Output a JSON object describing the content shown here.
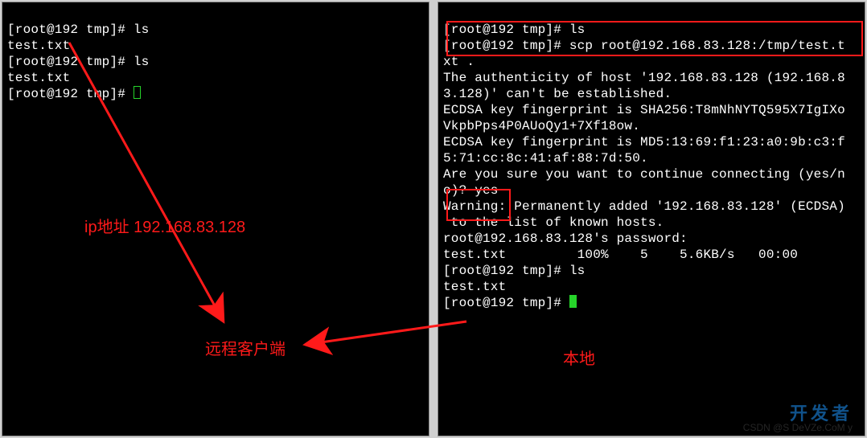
{
  "left_terminal": {
    "lines": [
      "[root@192 tmp]# ls",
      "test.txt",
      "[root@192 tmp]# ls",
      "test.txt",
      "[root@192 tmp]# "
    ]
  },
  "right_terminal": {
    "lines": [
      "[root@192 tmp]# ls",
      "[root@192 tmp]# scp root@192.168.83.128:/tmp/test.t",
      "xt .",
      "The authenticity of host '192.168.83.128 (192.168.8",
      "3.128)' can't be established.",
      "ECDSA key fingerprint is SHA256:T8mNhNYTQ595X7IgIXo",
      "VkpbPps4P0AUoQy1+7Xf18ow.",
      "ECDSA key fingerprint is MD5:13:69:f1:23:a0:9b:c3:f",
      "5:71:cc:8c:41:af:88:7d:50.",
      "Are you sure you want to continue connecting (yes/n",
      "o)? yes",
      "Warning: Permanently added '192.168.83.128' (ECDSA)",
      " to the list of known hosts.",
      "root@192.168.83.128's password:",
      "test.txt         100%    5    5.6KB/s   00:00",
      "[root@192 tmp]# ls",
      "test.txt",
      "[root@192 tmp]# "
    ]
  },
  "annotations": {
    "ip_label": "ip地址 192.168.83.128",
    "remote_label": "远程客户端",
    "local_label": "本地"
  },
  "watermark": {
    "title": "开发者",
    "subtitle": "CSDN @S DeVZe.CoM y"
  }
}
